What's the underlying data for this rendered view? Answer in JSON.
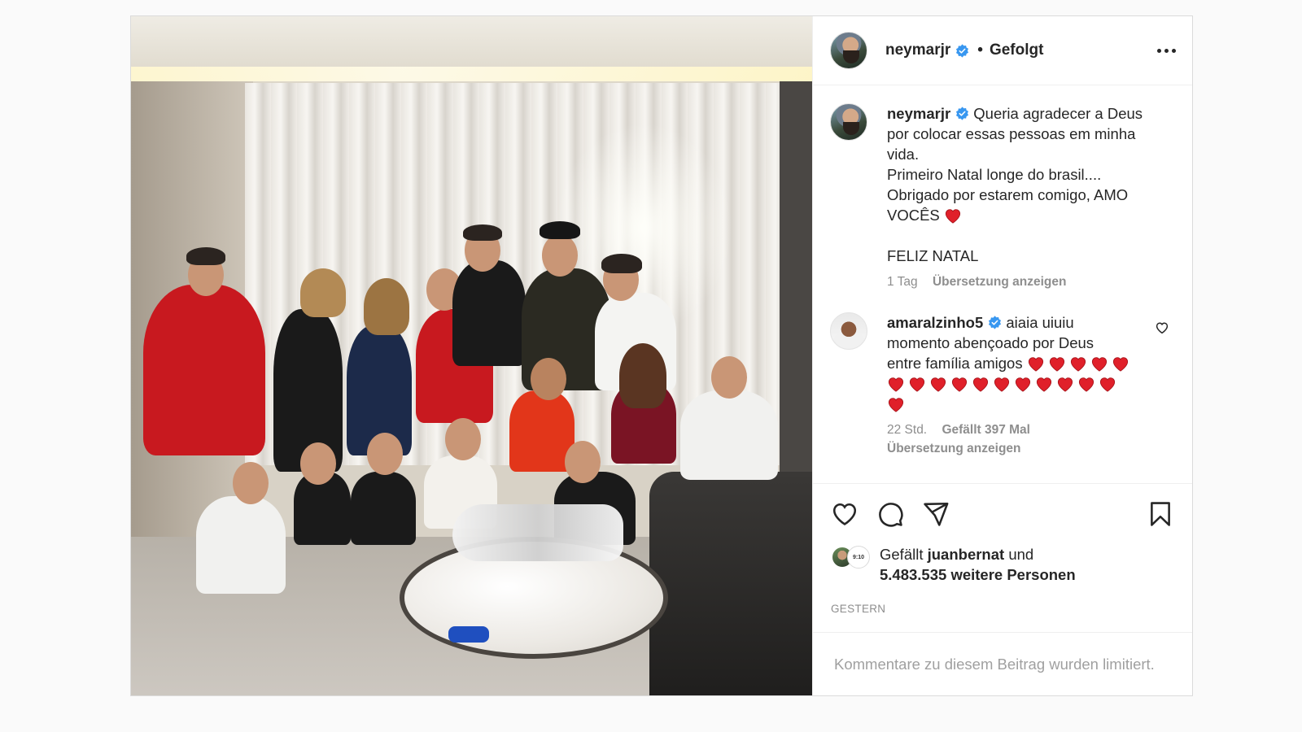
{
  "post": {
    "author": {
      "username": "neymarjr",
      "verified": true,
      "follow_status": "Gefolgt",
      "separator": "•"
    },
    "caption": {
      "username": "neymarjr",
      "lines": [
        "Queria agradecer a Deus",
        "por colocar essas pessoas em minha",
        "vida.",
        "Primeiro Natal longe do brasil....",
        "Obrigado por estarem comigo, AMO",
        "VOCÊS"
      ],
      "closing": "FELIZ NATAL",
      "time": "1 Tag",
      "translate_label": "Übersetzung anzeigen",
      "heart_count": 1
    },
    "comments": [
      {
        "username": "amaralzinho5",
        "verified": true,
        "text_lines": [
          "aiaia uiuiu",
          "momento abençoado por Deus",
          "entre família amigos"
        ],
        "hearts_line1": 5,
        "hearts_line2": 11,
        "hearts_line3": 1,
        "time": "22 Std.",
        "likes": "Gefällt 397 Mal",
        "translate_label": "Übersetzung anzeigen"
      }
    ],
    "likes": {
      "prefix": "Gefällt",
      "user": "juanbernat",
      "joiner": "und",
      "others": "5.483.535 weitere Personen",
      "badge": "9:10"
    },
    "date": "GESTERN",
    "comments_limited": "Kommentare zu diesem Beitrag wurden limitiert."
  },
  "colors": {
    "verified": "#3897f0",
    "heart": "#e0202a",
    "muted": "#8e8e8e",
    "border": "#dbdbdb"
  },
  "icons": [
    "heart-icon",
    "comment-icon",
    "share-icon",
    "bookmark-icon",
    "more-icon",
    "verified-icon",
    "small-heart-icon"
  ]
}
